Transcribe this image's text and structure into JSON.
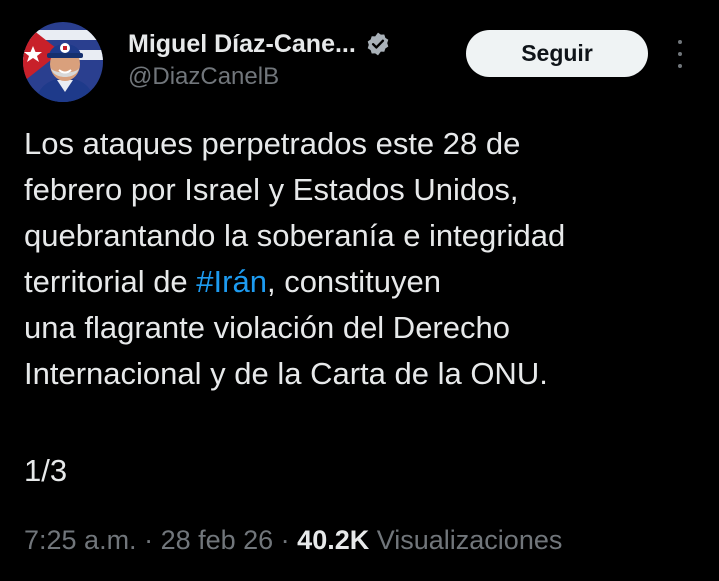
{
  "author": {
    "display_name": "Miguel Díaz-Cane...",
    "handle": "@DiazCanelB",
    "verified_icon": "verified-badge-icon",
    "avatar": "profile-photo"
  },
  "actions": {
    "follow_label": "Seguir",
    "more_icon": "more-vertical-icon"
  },
  "tweet": {
    "lines": [
      "Los ataques perpetrados este 28 de",
      "febrero por Israel y Estados Unidos,",
      "quebrantando la soberanía e integridad"
    ],
    "line4_before": "territorial de ",
    "hashtag": "#Irán",
    "line4_after": ", constituyen",
    "lines_end": [
      "una flagrante violación del Derecho",
      "Internacional y de la Carta de la ONU."
    ],
    "thread_count": "1/3"
  },
  "meta": {
    "time": "7:25 a.m.",
    "sep1": " · ",
    "date": "28 feb 26",
    "sep2": " · ",
    "views_count": "40.2K",
    "views_label": " Visualizaciones"
  },
  "colors": {
    "background": "#000000",
    "text": "#e7e9ea",
    "secondary": "#71767b",
    "link": "#1d9bf0",
    "button_bg": "#eff3f4"
  }
}
